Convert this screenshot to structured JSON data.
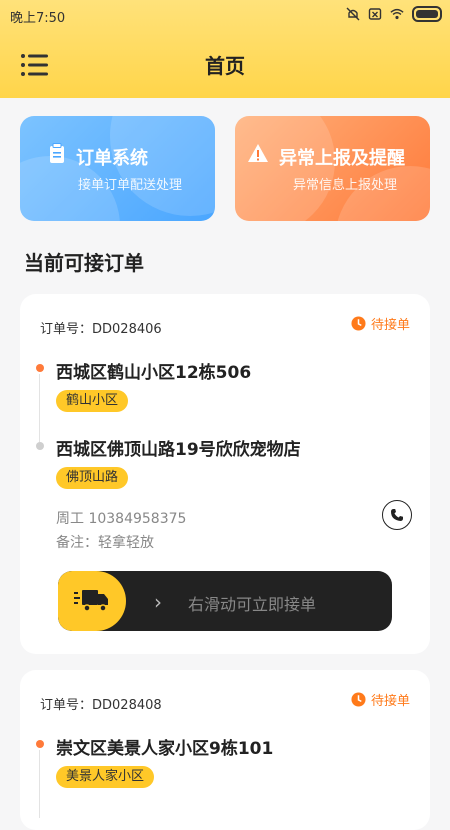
{
  "status_bar": {
    "time": "晚上7:50"
  },
  "header": {
    "title": "首页"
  },
  "quick_cards": [
    {
      "title": "订单系统",
      "subtitle": "接单订单配送处理",
      "icon": "clipboard-icon",
      "color": "#4aa6ff"
    },
    {
      "title": "异常上报及提醒",
      "subtitle": "异常信息上报处理",
      "icon": "warning-icon",
      "color": "#ff7a3a"
    }
  ],
  "section": {
    "title": "当前可接订单"
  },
  "orders": [
    {
      "order_no": "订单号：DD028406",
      "status": "待接单",
      "pickup": {
        "address": "西城区鹤山小区12栋506",
        "tag": "鹤山小区"
      },
      "dropoff": {
        "address": "西城区佛顶山路19号欣欣宠物店",
        "tag": "佛顶山路"
      },
      "contact": "周工  10384958375",
      "note": "备注：轻拿轻放",
      "slider_text": "右滑动可立即接单"
    },
    {
      "order_no": "订单号：DD028408",
      "status": "待接单",
      "pickup": {
        "address": "崇文区美景人家小区9栋101",
        "tag": "美景人家小区"
      }
    }
  ],
  "colors": {
    "accent": "#ffc828",
    "status": "#ff7a1a"
  }
}
